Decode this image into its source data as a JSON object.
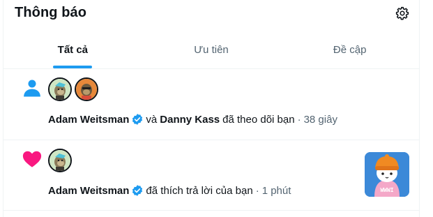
{
  "header": {
    "title": "Thông báo",
    "settings_icon": "gear-icon"
  },
  "tabs": [
    {
      "label": "Tất cả",
      "active": true
    },
    {
      "label": "Ưu tiên",
      "active": false
    },
    {
      "label": "Đề cập",
      "active": false
    }
  ],
  "notifications": [
    {
      "type_icon": "person-icon",
      "user1": "Adam Weitsman",
      "joiner": "và",
      "user2": "Danny Kass",
      "action": "đã theo dõi bạn",
      "separator": "·",
      "time": "38 giây"
    },
    {
      "type_icon": "heart-icon",
      "user1": "Adam Weitsman",
      "action": "đã thích trả lời của bạn",
      "separator": "·",
      "time": "1 phút",
      "thumbnail_text": "WWWI"
    }
  ],
  "colors": {
    "accent": "#1d9bf0",
    "like": "#f91880",
    "text": "#0f1419",
    "muted": "#536471",
    "verified": "#1d9bf0"
  }
}
